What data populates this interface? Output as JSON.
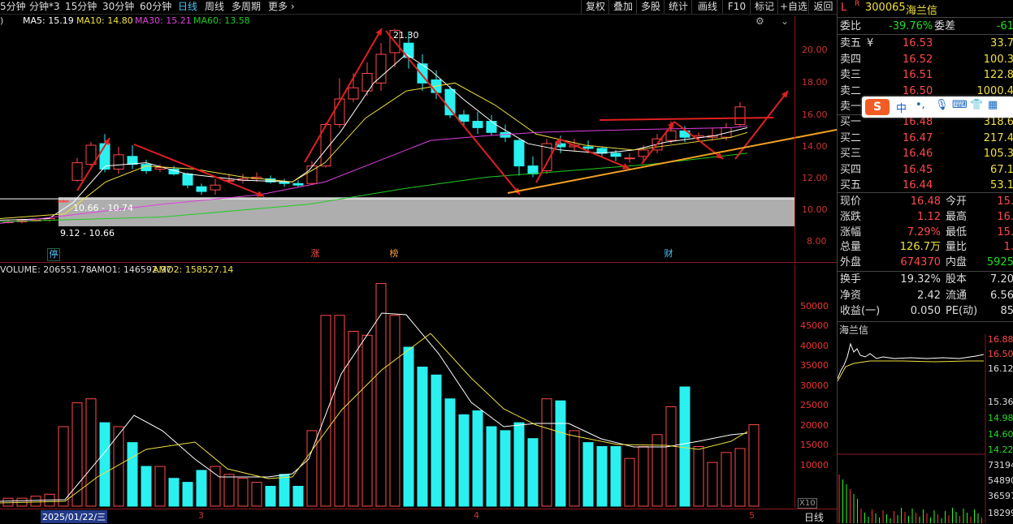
{
  "toolbar": {
    "periods": [
      "5分钟",
      "分钟*3",
      "15分钟",
      "30分钟",
      "60分钟",
      "日线",
      "周线",
      "多周期",
      "更多"
    ],
    "active": "日线",
    "tools": [
      "复权",
      "叠加",
      "多股",
      "统计",
      "画线",
      "F10",
      "标记",
      "+自选",
      "返回"
    ]
  },
  "ma_legend": {
    "ma5": "MA5: 15.19",
    "ma10": "MA10: 14.80",
    "ma30": "MA30: 15.21",
    "ma60": "MA60: 13.58",
    "colors": {
      "ma5": "#ffffff",
      "ma10": "#f0e040",
      "ma30": "#e040e0",
      "ma60": "#22cc22"
    }
  },
  "vol_legend": {
    "vol": "VOLUME: 206551.78",
    "amo1": "AMO1: 146592.97",
    "amo2": "AMO2: 158527.14"
  },
  "price_axis": [
    "20.00",
    "18.00",
    "16.00",
    "14.00",
    "12.00",
    "10.00",
    "8.00"
  ],
  "vol_axis": [
    "50000",
    "45000",
    "40000",
    "35000",
    "30000",
    "25000",
    "20000",
    "15000",
    "10000"
  ],
  "vol_unit": "X10",
  "annotations": {
    "high": "21.30",
    "zone_top": "10.66 - 10.74",
    "zone_bottom": "9.12 - 10.66"
  },
  "event_tags": [
    {
      "text": "停",
      "color": "#4fc3f7"
    },
    {
      "text": "涨",
      "color": "#ff4a4a"
    },
    {
      "text": "榜",
      "color": "#f0a040"
    },
    {
      "text": "财",
      "color": "#4fc3f7"
    }
  ],
  "x_axis": {
    "date": "2025/01/22/三",
    "months": [
      "3",
      "4",
      "5"
    ],
    "period": "日线"
  },
  "stock": {
    "flag": "L",
    "r": "R",
    "code": "300065",
    "name": "海兰信"
  },
  "order_book": {
    "weibi_label": "委比",
    "weibi": "-39.76%",
    "weicha_label": "委差",
    "weicha": "-61",
    "asks": [
      {
        "label": "卖五",
        "price": "16.53",
        "vol": "33.7",
        "mark": "¥"
      },
      {
        "label": "卖四",
        "price": "16.52",
        "vol": "100.3"
      },
      {
        "label": "卖三",
        "price": "16.51",
        "vol": "122.8"
      },
      {
        "label": "卖二",
        "price": "16.50",
        "vol": "1000.4"
      },
      {
        "label": "卖一",
        "price": "",
        "vol": ""
      }
    ],
    "bids": [
      {
        "label": "买一",
        "price": "16.48",
        "vol": "318.6"
      },
      {
        "label": "买二",
        "price": "16.47",
        "vol": "217.4"
      },
      {
        "label": "买三",
        "price": "16.46",
        "vol": "105.3"
      },
      {
        "label": "买四",
        "price": "16.45",
        "vol": "67.1"
      },
      {
        "label": "买五",
        "price": "16.44",
        "vol": "53.1"
      }
    ]
  },
  "quote": [
    {
      "l": "现价",
      "v": "16.48",
      "vc": "red",
      "l2": "今开",
      "v2": "15.",
      "v2c": "red"
    },
    {
      "l": "涨跌",
      "v": "1.12",
      "vc": "red",
      "l2": "最高",
      "v2": "16.",
      "v2c": "red"
    },
    {
      "l": "涨幅",
      "v": "7.29%",
      "vc": "red",
      "l2": "最低",
      "v2": "15.",
      "v2c": "red"
    },
    {
      "l": "总量",
      "v": "126.7万",
      "vc": "yel",
      "l2": "量比",
      "v2": "1.",
      "v2c": "red"
    },
    {
      "l": "外盘",
      "v": "674370",
      "vc": "red",
      "l2": "内盘",
      "v2": "5925",
      "v2c": "grn"
    }
  ],
  "fundamentals": [
    {
      "l": "换手",
      "v": "19.32%",
      "l2": "股本",
      "v2": "7.20"
    },
    {
      "l": "净资",
      "v": "2.42",
      "l2": "流通",
      "v2": "6.56"
    },
    {
      "l": "收益(一)",
      "v": "0.050",
      "l2": "PE(动)",
      "v2": "85"
    }
  ],
  "ime_bar": {
    "label": "中"
  },
  "mini_chart": {
    "title": "海兰信",
    "price_labels": [
      "16.88",
      "16.50",
      "16.12",
      "15.36",
      "14.98",
      "14.60",
      "14.22"
    ],
    "vol_labels": [
      "73194",
      "54890",
      "36597",
      "18299"
    ]
  }
}
